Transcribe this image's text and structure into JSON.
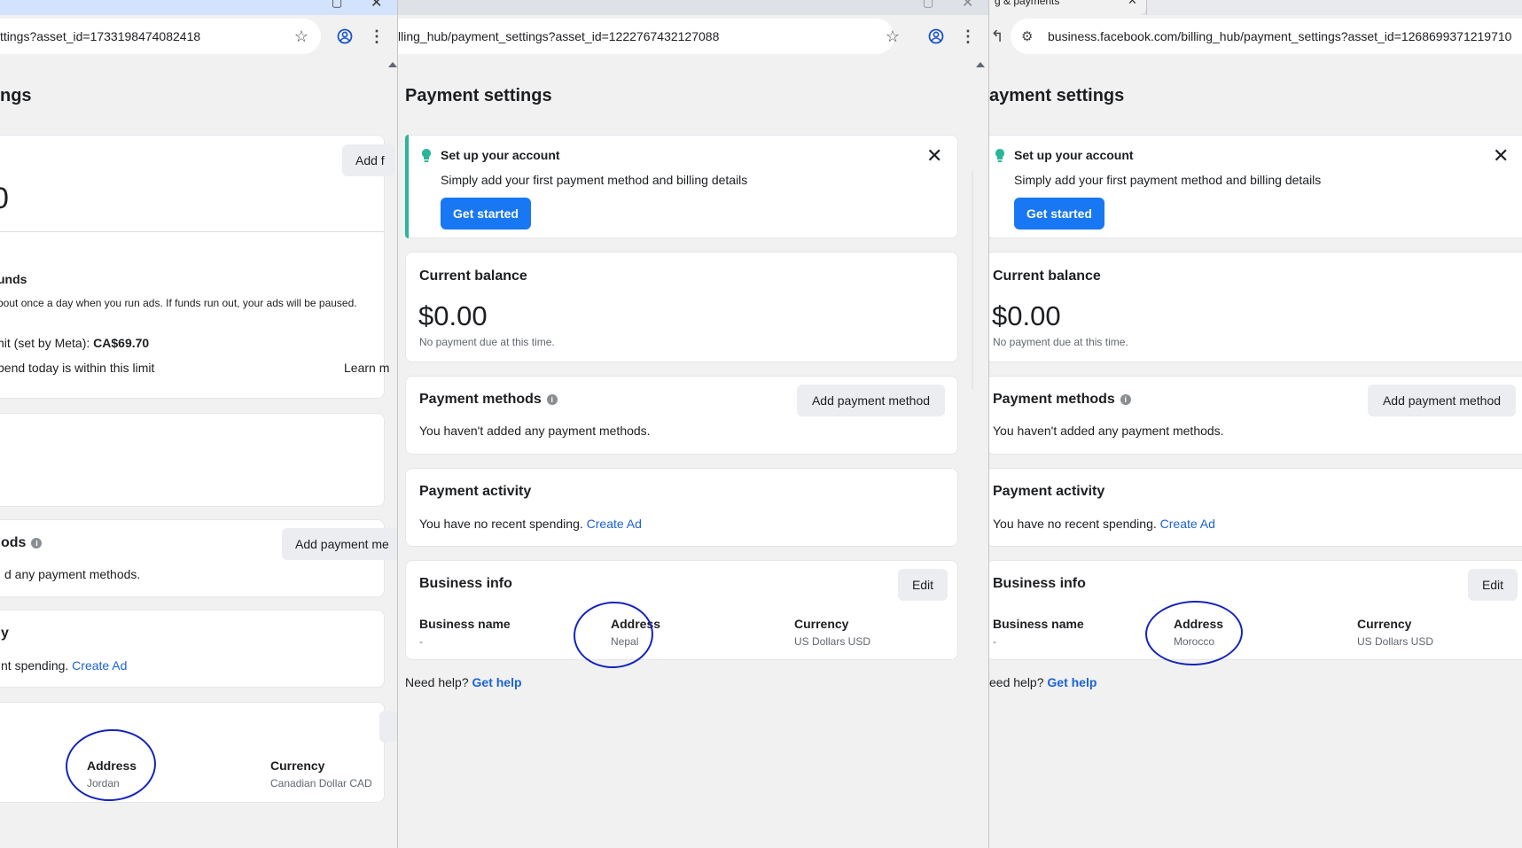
{
  "left": {
    "url": "ttings?asset_id=1733198474082418",
    "heading": "ngs",
    "add_button": "Add f",
    "balance_partial": "0",
    "funds_title": "unds",
    "funds_desc": "bout once a day when you run ads. If funds run out, your ads will be paused.",
    "limit_label": "nit (set by Meta): ",
    "limit_value": "CA$69.70",
    "spend_text": "pend today is within this limit",
    "learn": "Learn m",
    "methods_title": "ods",
    "add_payment": "Add payment me",
    "methods_desc": "d any payment methods.",
    "activity_title": "y",
    "activity_desc": "nt spending. ",
    "create_ad": "Create Ad",
    "address_label": "Address",
    "address_value": "Jordan",
    "currency_label": "Currency",
    "currency_value": "Canadian Dollar CAD"
  },
  "middle": {
    "url": "lling_hub/payment_settings?asset_id=1222767432127088",
    "heading": "Payment settings",
    "setup_title": "Set up your account",
    "setup_desc": "Simply add your first payment method and billing details",
    "get_started": "Get started",
    "balance_title": "Current balance",
    "balance": "$0.00",
    "balance_note": "No payment due at this time.",
    "methods_title": "Payment methods",
    "add_payment": "Add payment method",
    "methods_desc": "You haven't added any payment methods.",
    "activity_title": "Payment activity",
    "activity_desc": "You have no recent spending. ",
    "create_ad": "Create Ad",
    "business_title": "Business info",
    "edit": "Edit",
    "bname_label": "Business name",
    "bname_value": "-",
    "address_label": "Address",
    "address_value": "Nepal",
    "currency_label": "Currency",
    "currency_value": "US Dollars USD",
    "help": "Need help? ",
    "get_help": "Get help"
  },
  "right": {
    "tab_title": "g & payments",
    "url": "business.facebook.com/billing_hub/payment_settings?asset_id=1268699371219710",
    "heading": "ayment settings",
    "setup_title": "Set up your account",
    "setup_desc": "Simply add your first payment method and billing details",
    "get_started": "Get started",
    "balance_title": "Current balance",
    "balance": "$0.00",
    "balance_note": "No payment due at this time.",
    "methods_title": "Payment methods",
    "add_payment": "Add payment method",
    "methods_desc": "You haven't added any payment methods.",
    "activity_title": "Payment activity",
    "activity_desc": "You have no recent spending. ",
    "create_ad": "Create Ad",
    "business_title": "Business info",
    "edit": "Edit",
    "bname_label": "Business name",
    "bname_value": "-",
    "address_label": "Address",
    "address_value": "Morocco",
    "currency_label": "Currency",
    "currency_value": "US Dollars USD",
    "help": "eed help? ",
    "get_help": "Get help"
  },
  "icons": {
    "star": "star-icon",
    "profile": "profile-icon",
    "menu": "more-vert-icon",
    "close": "close-icon",
    "bulb": "lightbulb-icon",
    "info": "info-icon",
    "site_settings": "site-settings-icon"
  },
  "colors": {
    "accent_green": "#2ab69a",
    "primary_blue": "#1877f2",
    "link_blue": "#1b62d6",
    "annotation_ink": "#1525b8"
  }
}
